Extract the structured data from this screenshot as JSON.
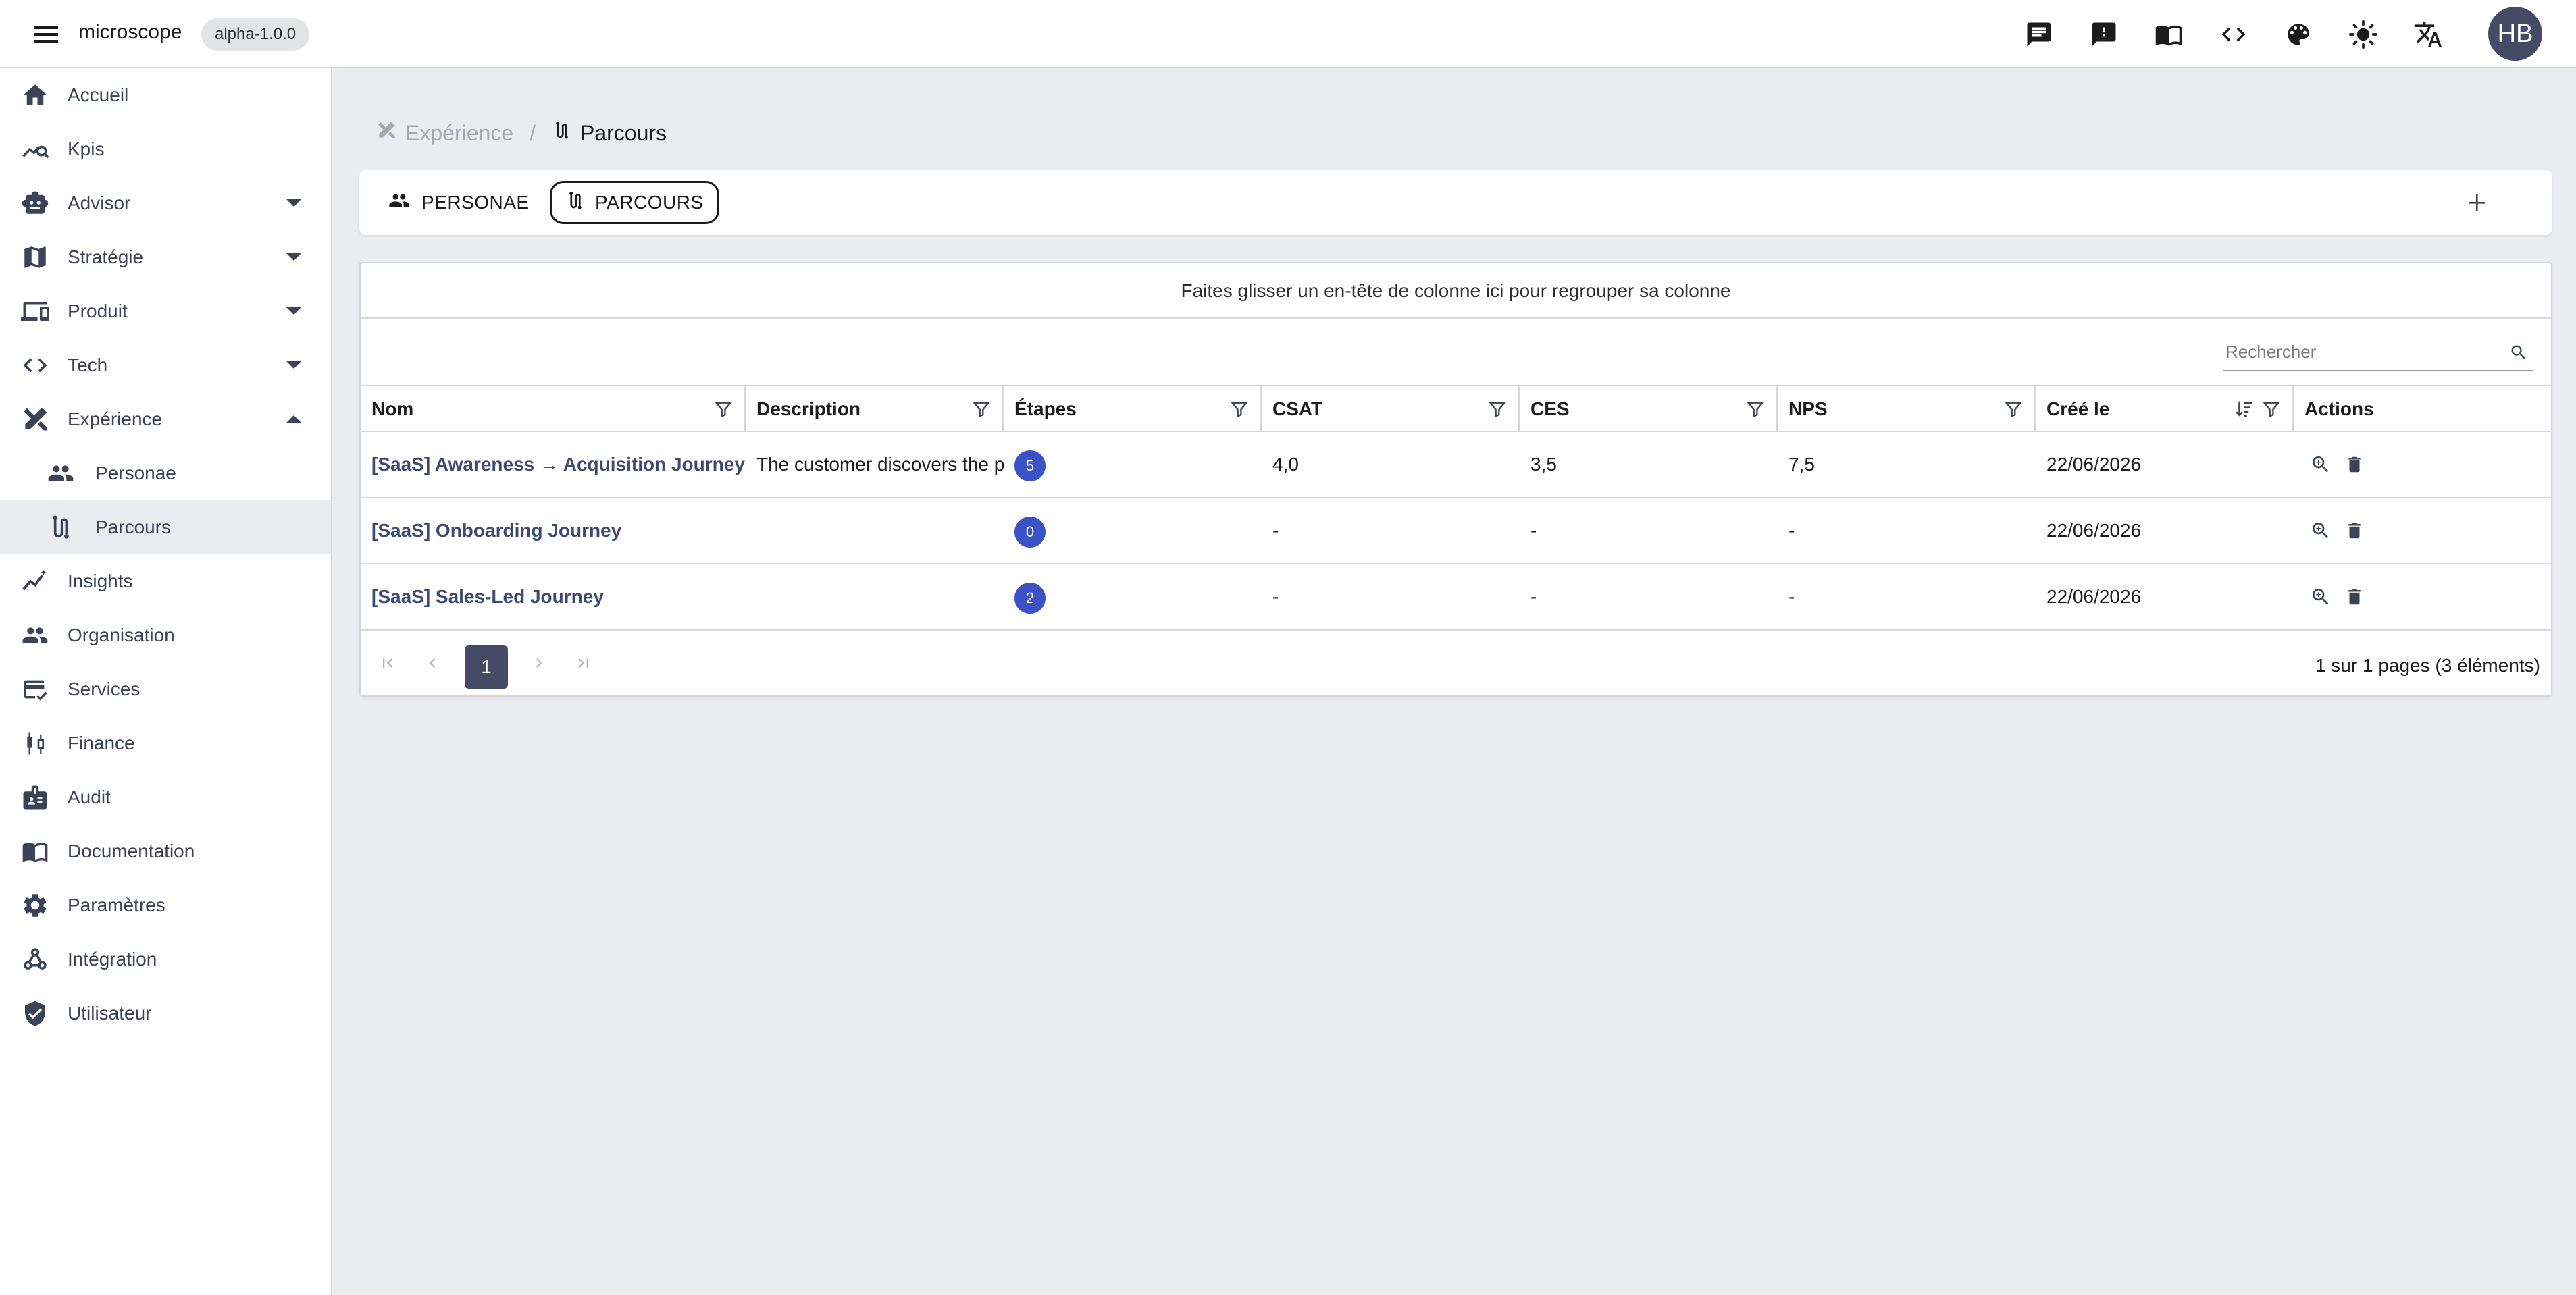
{
  "app": {
    "title": "microscope",
    "version": "alpha-1.0.0",
    "avatar_initials": "HB"
  },
  "topbar_icons": [
    "chat-icon",
    "feedback-icon",
    "book-icon",
    "code-icon",
    "palette-icon",
    "brightness-icon",
    "translate-icon"
  ],
  "sidebar": {
    "items": [
      {
        "label": "Accueil",
        "icon": "home-icon"
      },
      {
        "label": "Kpis",
        "icon": "kpi-chart-icon"
      },
      {
        "label": "Advisor",
        "icon": "robot-icon",
        "caret": "down"
      },
      {
        "label": "Stratégie",
        "icon": "map-icon",
        "caret": "down"
      },
      {
        "label": "Produit",
        "icon": "devices-icon",
        "caret": "down"
      },
      {
        "label": "Tech",
        "icon": "code-icon",
        "caret": "down"
      },
      {
        "label": "Expérience",
        "icon": "design-tools-icon",
        "caret": "up"
      },
      {
        "label": "Personae",
        "icon": "people-icon",
        "sub": true
      },
      {
        "label": "Parcours",
        "icon": "route-icon",
        "sub": true,
        "active": true
      },
      {
        "label": "Insights",
        "icon": "insights-icon"
      },
      {
        "label": "Organisation",
        "icon": "group-icon"
      },
      {
        "label": "Services",
        "icon": "card-check-icon"
      },
      {
        "label": "Finance",
        "icon": "candlestick-icon"
      },
      {
        "label": "Audit",
        "icon": "badge-icon"
      },
      {
        "label": "Documentation",
        "icon": "book-icon"
      },
      {
        "label": "Paramètres",
        "icon": "gear-icon"
      },
      {
        "label": "Intégration",
        "icon": "webhook-icon"
      },
      {
        "label": "Utilisateur",
        "icon": "shield-icon"
      }
    ]
  },
  "breadcrumb": {
    "parent": "Expérience",
    "current": "Parcours"
  },
  "tabs": [
    {
      "label": "PERSONAE",
      "icon": "people-icon"
    },
    {
      "label": "PARCOURS",
      "icon": "route-icon",
      "selected": true
    }
  ],
  "grid": {
    "group_panel_text": "Faites glisser un en-tête de colonne ici pour regrouper sa colonne",
    "search_placeholder": "Rechercher",
    "columns": [
      "Nom",
      "Description",
      "Étapes",
      "CSAT",
      "CES",
      "NPS",
      "Créé le",
      "Actions"
    ],
    "rows": [
      {
        "nom": "[SaaS] Awareness → Acquisition Journey",
        "description": "The customer discovers the p",
        "etapes": "5",
        "csat": "4,0",
        "ces": "3,5",
        "nps": "7,5",
        "cree_le": "22/06/2026"
      },
      {
        "nom": "[SaaS] Onboarding Journey",
        "description": "",
        "etapes": "0",
        "csat": "-",
        "ces": "-",
        "nps": "-",
        "cree_le": "22/06/2026"
      },
      {
        "nom": "[SaaS] Sales-Led Journey",
        "description": "",
        "etapes": "2",
        "csat": "-",
        "ces": "-",
        "nps": "-",
        "cree_le": "22/06/2026"
      }
    ],
    "pager": {
      "current_page": "1",
      "info": "1 sur 1 pages (3 éléments)"
    }
  },
  "colors": {
    "accent_dark": "#454b64",
    "badge_blue": "#3b53c6",
    "background": "#ebecf0"
  }
}
